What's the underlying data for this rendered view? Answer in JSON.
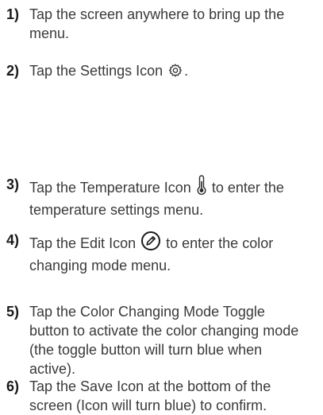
{
  "steps": [
    {
      "number": "1)",
      "text": "Tap the screen anywhere to bring up the menu."
    },
    {
      "number": "2)",
      "text_before": "Tap the Settings Icon",
      "icon": "gear-icon",
      "text_after": "."
    },
    {
      "number": "3)",
      "text_before": "Tap the Temperature Icon",
      "icon": "thermometer-icon",
      "text_after": "to enter the temperature settings menu."
    },
    {
      "number": "4)",
      "text_before": "Tap the Edit Icon",
      "icon": "edit-pencil-icon",
      "text_after": "to enter the color changing mode menu."
    },
    {
      "number": "5)",
      "text": "Tap the Color Changing Mode Toggle button to activate the color changing mode (the toggle button will turn blue when active)."
    },
    {
      "number": "6)",
      "text": "Tap the Save Icon at the bottom of the screen (Icon will turn blue) to confirm."
    }
  ]
}
